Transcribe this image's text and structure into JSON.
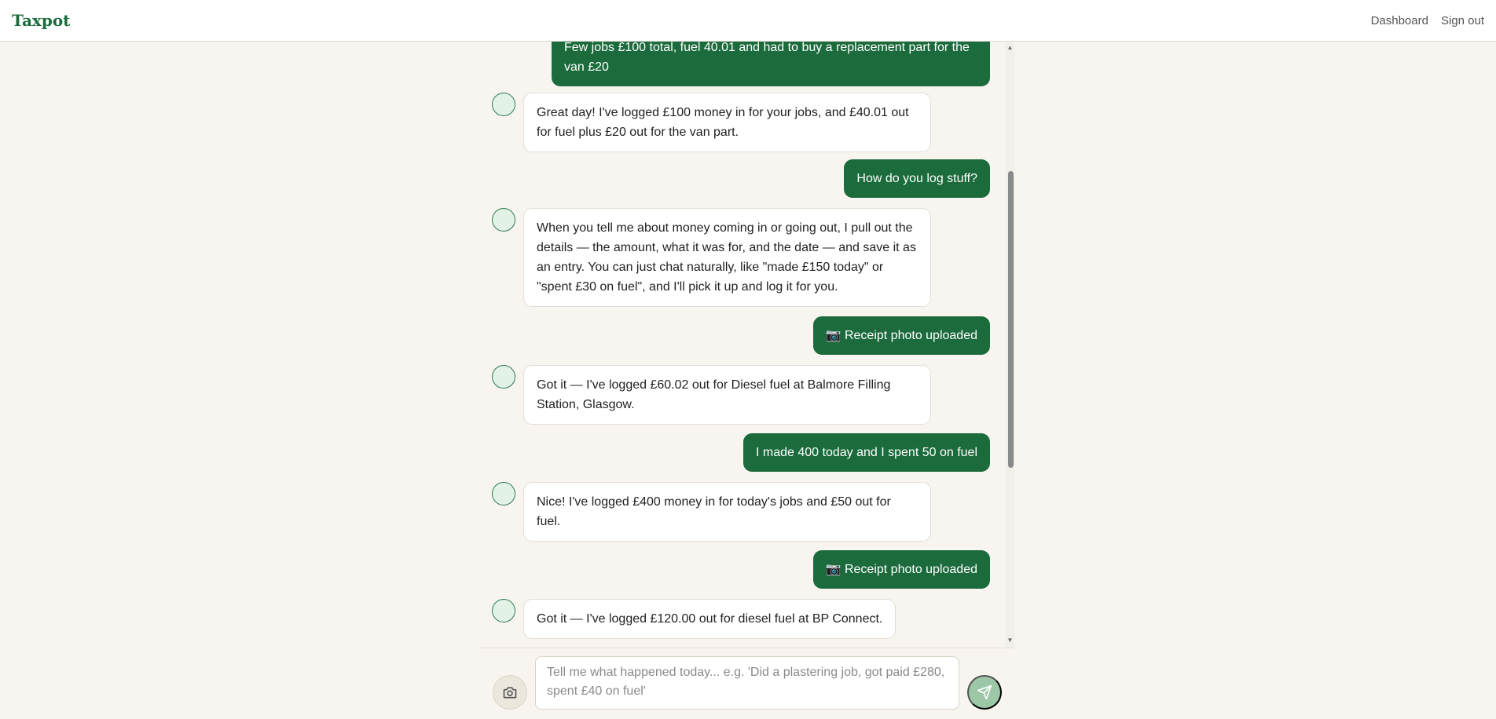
{
  "header": {
    "brand": "Taxpot",
    "nav": {
      "dashboard": "Dashboard",
      "sign_out": "Sign out"
    }
  },
  "messages": [
    {
      "role": "user",
      "text": "Few jobs £100 total, fuel 40.01 and had to buy a replacement part for the van £20"
    },
    {
      "role": "assistant",
      "text": "Great day! I've logged £100 money in for your jobs, and £40.01 out for fuel plus £20 out for the van part."
    },
    {
      "role": "user",
      "text": "How do you log stuff?"
    },
    {
      "role": "assistant",
      "text": "When you tell me about money coming in or going out, I pull out the details — the amount, what it was for, and the date — and save it as an entry. You can just chat naturally, like \"made £150 today\" or \"spent £30 on fuel\", and I'll pick it up and log it for you."
    },
    {
      "role": "user",
      "text": "📷 Receipt photo uploaded"
    },
    {
      "role": "assistant",
      "text": "Got it — I've logged £60.02 out for Diesel fuel at Balmore Filling Station, Glasgow."
    },
    {
      "role": "user",
      "text": "I made 400 today and I spent 50 on fuel"
    },
    {
      "role": "assistant",
      "text": "Nice! I've logged £400 money in for today's jobs and £50 out for fuel."
    },
    {
      "role": "user",
      "text": "📷 Receipt photo uploaded"
    },
    {
      "role": "assistant",
      "text": "Got it — I've logged £120.00 out for diesel fuel at BP Connect."
    }
  ],
  "composer": {
    "placeholder": "Tell me what happened today... e.g. 'Did a plastering job, got paid £280, spent £40 on fuel'",
    "value": ""
  },
  "icons": {
    "camera": "camera-icon",
    "send": "send-icon",
    "avatar": "assistant-avatar"
  },
  "colors": {
    "accent": "#1b6b3c",
    "background": "#f8f5f0",
    "send_disabled": "#9cc8a8"
  }
}
